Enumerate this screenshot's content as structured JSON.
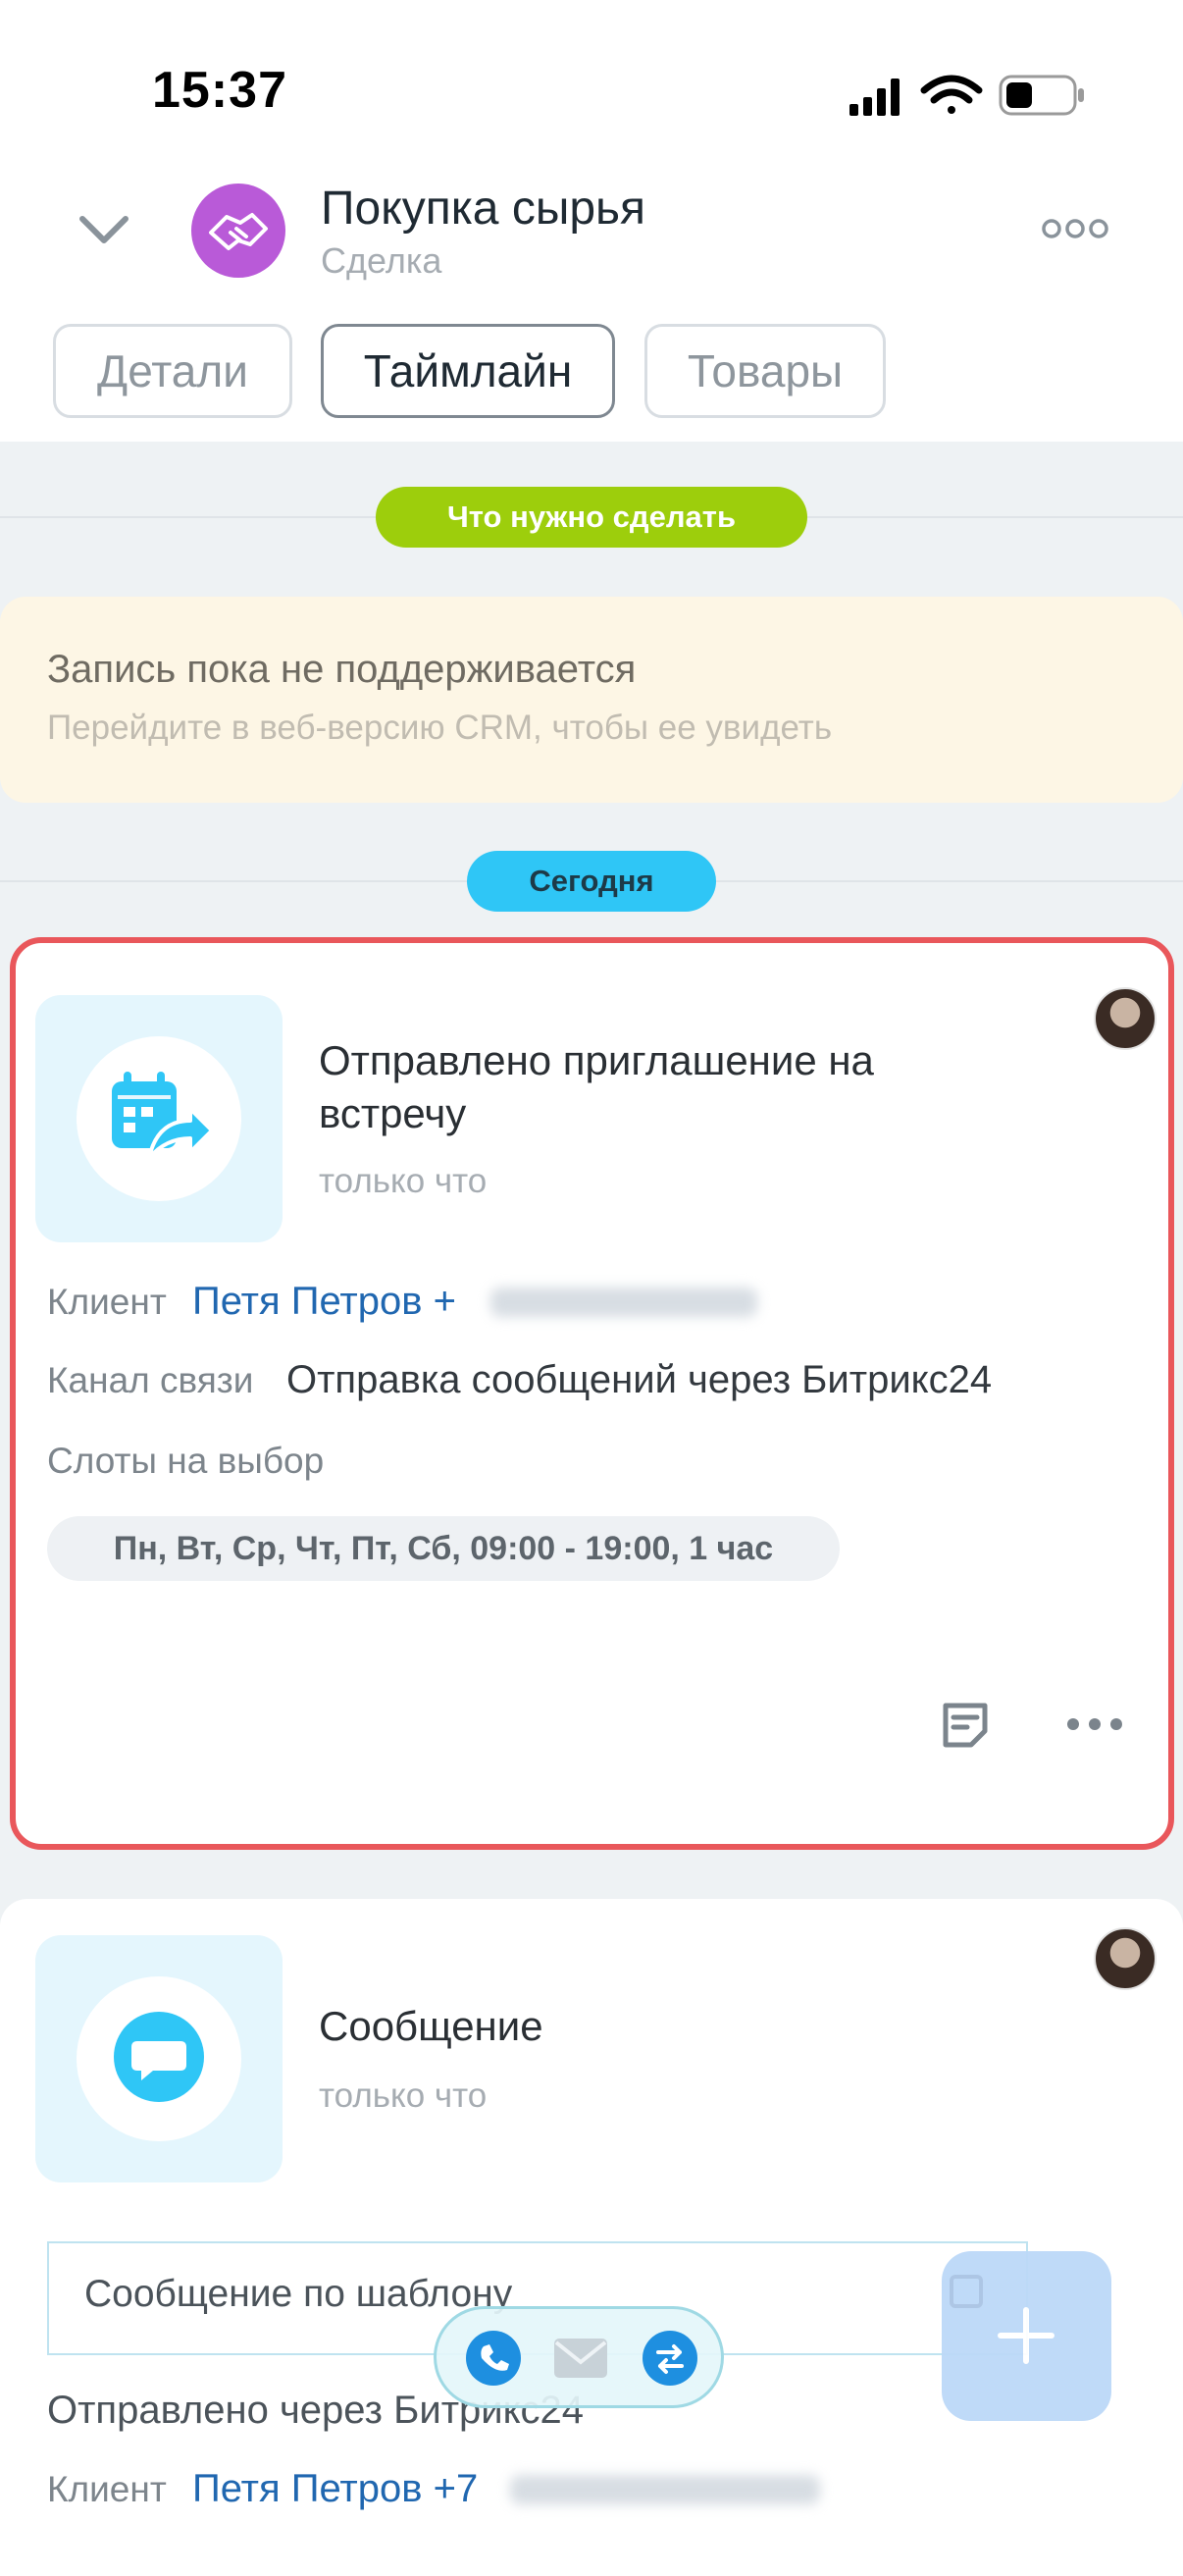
{
  "status_bar": {
    "time": "15:37"
  },
  "deal": {
    "title": "Покупка сырья",
    "subtitle": "Сделка"
  },
  "tabs": [
    {
      "label": "Детали"
    },
    {
      "label": "Таймлайн"
    },
    {
      "label": "Товары"
    }
  ],
  "todo_pill": "Что нужно сделать",
  "banner": {
    "title": "Запись пока не поддерживается",
    "subtitle": "Перейдите в веб-версию CRM, чтобы ее увидеть"
  },
  "today_pill": "Сегодня",
  "card_invite": {
    "title": "Отправлено приглашение на встречу",
    "time": "только что",
    "client_label": "Клиент",
    "client_value": "Петя Петров +",
    "channel_label": "Канал связи",
    "channel_value": "Отправка сообщений через Битрикс24",
    "slots_label": "Слоты на выбор",
    "slots_value": "Пн, Вт, Ср, Чт, Пт, Сб, 09:00 - 19:00, 1 час"
  },
  "card_message": {
    "title": "Сообщение",
    "time": "только что",
    "template_text": "Сообщение по шаблону",
    "sent_via": "Отправлено через Битрикс24",
    "client_label": "Клиент",
    "client_value": "Петя Петров +7"
  },
  "colors": {
    "accent_green": "#9dce0c",
    "accent_blue": "#2fc6f6",
    "deal_avatar": "#b95ad8",
    "link": "#2067b0",
    "highlight_outline": "#e9575b"
  }
}
